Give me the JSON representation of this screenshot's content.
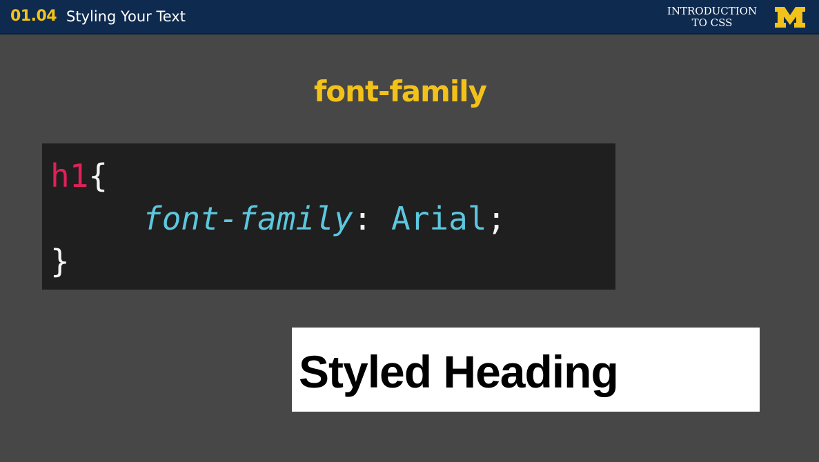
{
  "header": {
    "lesson_number": "01.04",
    "lesson_title": "Styling Your Text",
    "course_title_line1": "INTRODUCTION",
    "course_title_line2": "TO CSS",
    "logo": "block-m-logo",
    "logo_letter": "M",
    "brand_colors": {
      "navy": "#0e2a4f",
      "maize": "#f3c21a"
    }
  },
  "slide": {
    "title": "font-family",
    "code": {
      "selector": "h1",
      "open_brace": "{",
      "property": "font-family",
      "colon": ":",
      "value": "Arial",
      "semicolon": ";",
      "close_brace": "}"
    },
    "preview_text": "Styled Heading"
  }
}
